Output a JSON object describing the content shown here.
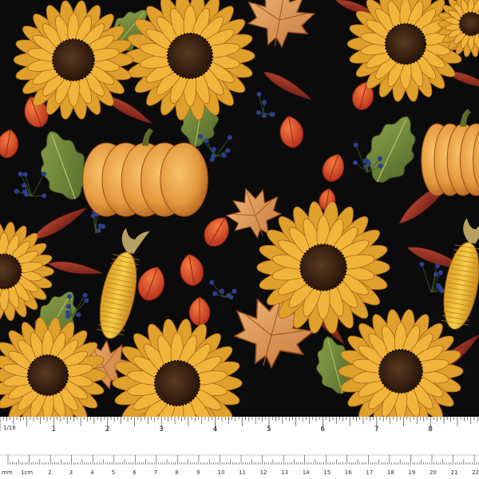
{
  "image": {
    "subject": "autumn floral fabric swatch",
    "motifs": [
      "sunflower",
      "pumpkin",
      "corn",
      "chinese-lantern",
      "maple-leaf",
      "oak-leaf",
      "blueberry-sprig"
    ]
  },
  "colors": {
    "background": "#0b0b0b",
    "sunflower_petal": "#f0b53a",
    "sunflower_center": "#3a2414",
    "pumpkin": "#e59a3e",
    "lantern": "#dd4a1f",
    "leaf_green": "#6f8a3a",
    "leaf_red": "#8d2a22",
    "maple": "#e6a25c",
    "berry": "#2d3f8f"
  },
  "ruler": {
    "inch_fraction_label": "1/16",
    "inch_numbers": [
      "1",
      "2",
      "3",
      "4",
      "5",
      "6",
      "7",
      "8"
    ],
    "mm_label": "mm",
    "cm_label": "1cm",
    "cm_numbers": [
      "2",
      "3",
      "4",
      "5",
      "6",
      "7",
      "8",
      "9",
      "10",
      "11",
      "12",
      "13",
      "14",
      "15",
      "16",
      "17",
      "18",
      "19",
      "20",
      "21",
      "22"
    ]
  }
}
